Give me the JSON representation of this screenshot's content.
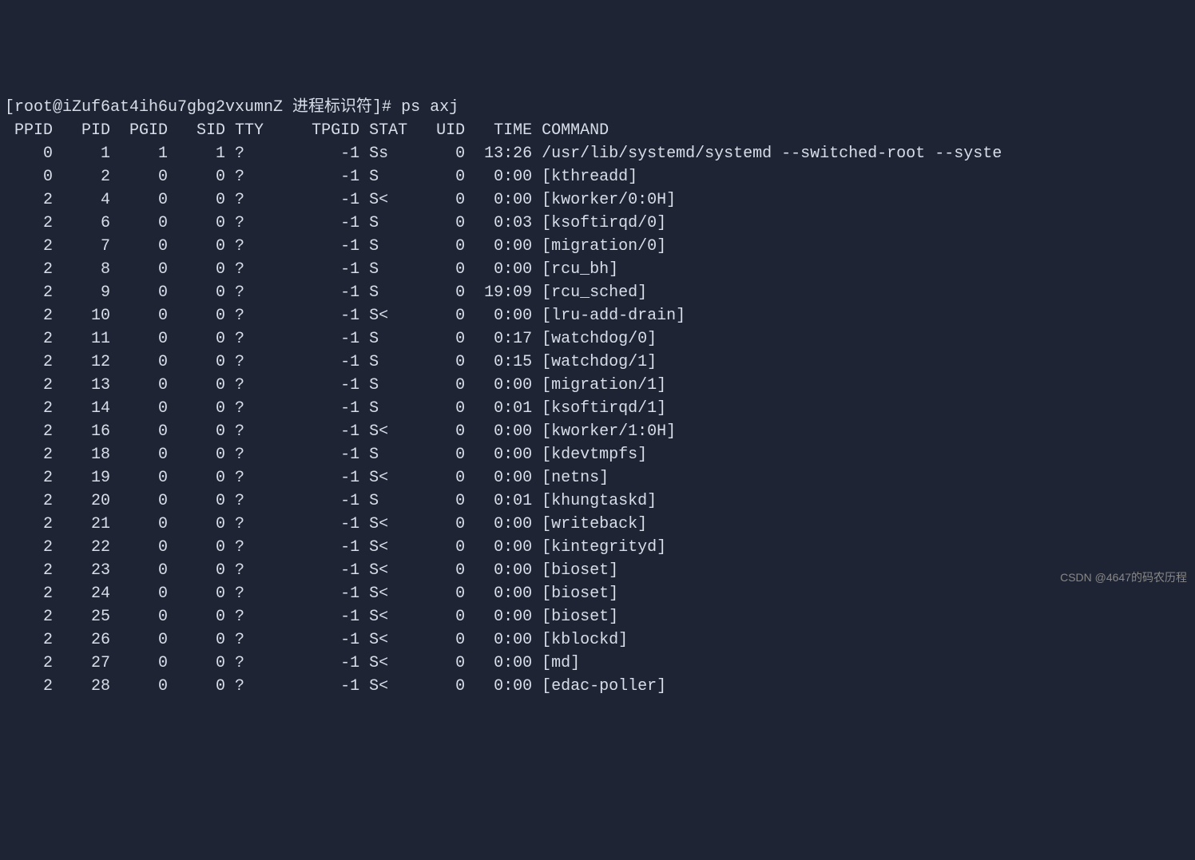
{
  "prompt": "[root@iZuf6at4ih6u7gbg2vxumnZ 进程标识符]# ps axj",
  "headers": [
    "PPID",
    "PID",
    "PGID",
    "SID",
    "TTY",
    "TPGID",
    "STAT",
    "UID",
    "TIME",
    "COMMAND"
  ],
  "rows": [
    {
      "ppid": "0",
      "pid": "1",
      "pgid": "1",
      "sid": "1",
      "tty": "?",
      "tpgid": "-1",
      "stat": "Ss",
      "uid": "0",
      "time": "13:26",
      "command": "/usr/lib/systemd/systemd --switched-root --syste"
    },
    {
      "ppid": "0",
      "pid": "2",
      "pgid": "0",
      "sid": "0",
      "tty": "?",
      "tpgid": "-1",
      "stat": "S",
      "uid": "0",
      "time": "0:00",
      "command": "[kthreadd]"
    },
    {
      "ppid": "2",
      "pid": "4",
      "pgid": "0",
      "sid": "0",
      "tty": "?",
      "tpgid": "-1",
      "stat": "S<",
      "uid": "0",
      "time": "0:00",
      "command": "[kworker/0:0H]"
    },
    {
      "ppid": "2",
      "pid": "6",
      "pgid": "0",
      "sid": "0",
      "tty": "?",
      "tpgid": "-1",
      "stat": "S",
      "uid": "0",
      "time": "0:03",
      "command": "[ksoftirqd/0]"
    },
    {
      "ppid": "2",
      "pid": "7",
      "pgid": "0",
      "sid": "0",
      "tty": "?",
      "tpgid": "-1",
      "stat": "S",
      "uid": "0",
      "time": "0:00",
      "command": "[migration/0]"
    },
    {
      "ppid": "2",
      "pid": "8",
      "pgid": "0",
      "sid": "0",
      "tty": "?",
      "tpgid": "-1",
      "stat": "S",
      "uid": "0",
      "time": "0:00",
      "command": "[rcu_bh]"
    },
    {
      "ppid": "2",
      "pid": "9",
      "pgid": "0",
      "sid": "0",
      "tty": "?",
      "tpgid": "-1",
      "stat": "S",
      "uid": "0",
      "time": "19:09",
      "command": "[rcu_sched]"
    },
    {
      "ppid": "2",
      "pid": "10",
      "pgid": "0",
      "sid": "0",
      "tty": "?",
      "tpgid": "-1",
      "stat": "S<",
      "uid": "0",
      "time": "0:00",
      "command": "[lru-add-drain]"
    },
    {
      "ppid": "2",
      "pid": "11",
      "pgid": "0",
      "sid": "0",
      "tty": "?",
      "tpgid": "-1",
      "stat": "S",
      "uid": "0",
      "time": "0:17",
      "command": "[watchdog/0]"
    },
    {
      "ppid": "2",
      "pid": "12",
      "pgid": "0",
      "sid": "0",
      "tty": "?",
      "tpgid": "-1",
      "stat": "S",
      "uid": "0",
      "time": "0:15",
      "command": "[watchdog/1]"
    },
    {
      "ppid": "2",
      "pid": "13",
      "pgid": "0",
      "sid": "0",
      "tty": "?",
      "tpgid": "-1",
      "stat": "S",
      "uid": "0",
      "time": "0:00",
      "command": "[migration/1]"
    },
    {
      "ppid": "2",
      "pid": "14",
      "pgid": "0",
      "sid": "0",
      "tty": "?",
      "tpgid": "-1",
      "stat": "S",
      "uid": "0",
      "time": "0:01",
      "command": "[ksoftirqd/1]"
    },
    {
      "ppid": "2",
      "pid": "16",
      "pgid": "0",
      "sid": "0",
      "tty": "?",
      "tpgid": "-1",
      "stat": "S<",
      "uid": "0",
      "time": "0:00",
      "command": "[kworker/1:0H]"
    },
    {
      "ppid": "2",
      "pid": "18",
      "pgid": "0",
      "sid": "0",
      "tty": "?",
      "tpgid": "-1",
      "stat": "S",
      "uid": "0",
      "time": "0:00",
      "command": "[kdevtmpfs]"
    },
    {
      "ppid": "2",
      "pid": "19",
      "pgid": "0",
      "sid": "0",
      "tty": "?",
      "tpgid": "-1",
      "stat": "S<",
      "uid": "0",
      "time": "0:00",
      "command": "[netns]"
    },
    {
      "ppid": "2",
      "pid": "20",
      "pgid": "0",
      "sid": "0",
      "tty": "?",
      "tpgid": "-1",
      "stat": "S",
      "uid": "0",
      "time": "0:01",
      "command": "[khungtaskd]"
    },
    {
      "ppid": "2",
      "pid": "21",
      "pgid": "0",
      "sid": "0",
      "tty": "?",
      "tpgid": "-1",
      "stat": "S<",
      "uid": "0",
      "time": "0:00",
      "command": "[writeback]"
    },
    {
      "ppid": "2",
      "pid": "22",
      "pgid": "0",
      "sid": "0",
      "tty": "?",
      "tpgid": "-1",
      "stat": "S<",
      "uid": "0",
      "time": "0:00",
      "command": "[kintegrityd]"
    },
    {
      "ppid": "2",
      "pid": "23",
      "pgid": "0",
      "sid": "0",
      "tty": "?",
      "tpgid": "-1",
      "stat": "S<",
      "uid": "0",
      "time": "0:00",
      "command": "[bioset]"
    },
    {
      "ppid": "2",
      "pid": "24",
      "pgid": "0",
      "sid": "0",
      "tty": "?",
      "tpgid": "-1",
      "stat": "S<",
      "uid": "0",
      "time": "0:00",
      "command": "[bioset]"
    },
    {
      "ppid": "2",
      "pid": "25",
      "pgid": "0",
      "sid": "0",
      "tty": "?",
      "tpgid": "-1",
      "stat": "S<",
      "uid": "0",
      "time": "0:00",
      "command": "[bioset]"
    },
    {
      "ppid": "2",
      "pid": "26",
      "pgid": "0",
      "sid": "0",
      "tty": "?",
      "tpgid": "-1",
      "stat": "S<",
      "uid": "0",
      "time": "0:00",
      "command": "[kblockd]"
    },
    {
      "ppid": "2",
      "pid": "27",
      "pgid": "0",
      "sid": "0",
      "tty": "?",
      "tpgid": "-1",
      "stat": "S<",
      "uid": "0",
      "time": "0:00",
      "command": "[md]"
    },
    {
      "ppid": "2",
      "pid": "28",
      "pgid": "0",
      "sid": "0",
      "tty": "?",
      "tpgid": "-1",
      "stat": "S<",
      "uid": "0",
      "time": "0:00",
      "command": "[edac-poller]"
    }
  ],
  "watermark": "CSDN @4647的码农历程"
}
